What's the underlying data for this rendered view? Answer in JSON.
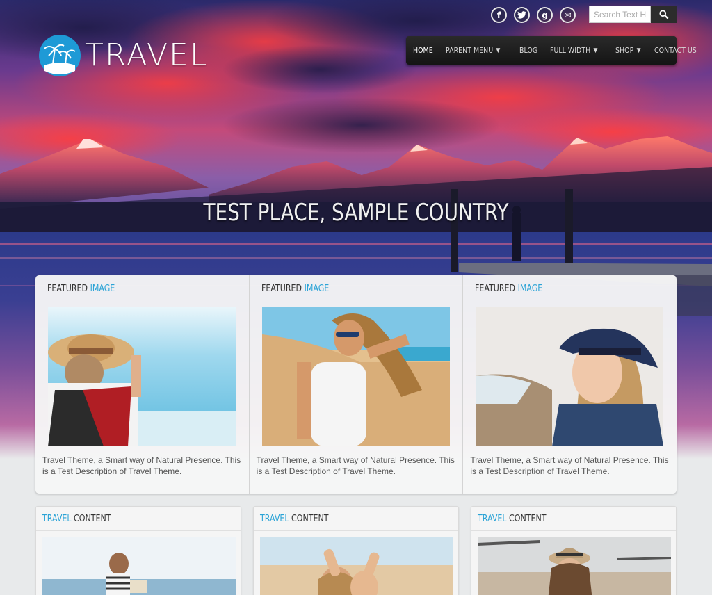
{
  "brand": {
    "logo_text": "TRAVEL"
  },
  "social": [
    {
      "icon": "facebook-icon",
      "glyph": "f"
    },
    {
      "icon": "twitter-icon",
      "glyph": "t"
    },
    {
      "icon": "google-plus-icon",
      "glyph": "g"
    },
    {
      "icon": "email-icon",
      "glyph": "✉"
    }
  ],
  "search": {
    "placeholder": "Search Text H",
    "button_icon": "search-icon"
  },
  "nav": {
    "items": [
      {
        "label": "Home",
        "active": true,
        "has_dropdown": false
      },
      {
        "label": "Parent Menu",
        "has_dropdown": true
      },
      {
        "label": "Blog",
        "has_dropdown": false
      },
      {
        "label": "Full Width",
        "has_dropdown": true
      },
      {
        "label": "Shop",
        "has_dropdown": true
      },
      {
        "label": "Contact Us",
        "has_dropdown": false
      }
    ],
    "caret": "▼"
  },
  "hero": {
    "title": "TEST PLACE, SAMPLE COUNTRY"
  },
  "featured": {
    "items": [
      {
        "heading_main": "FEATURED",
        "heading_accent": "IMAGE",
        "description": "Travel Theme, a Smart way of Natural Presence. This is a Test Description of Travel Theme."
      },
      {
        "heading_main": "FEATURED",
        "heading_accent": "IMAGE",
        "description": "Travel Theme, a Smart way of Natural Presence. This is a Test Description of Travel Theme."
      },
      {
        "heading_main": "FEATURED",
        "heading_accent": "IMAGE",
        "description": "Travel Theme, a Smart way of Natural Presence. This is a Test Description of Travel Theme."
      }
    ]
  },
  "content": {
    "items": [
      {
        "heading_accent": "TRAVEL",
        "heading_main": "CONTENT"
      },
      {
        "heading_accent": "TRAVEL",
        "heading_main": "CONTENT"
      },
      {
        "heading_accent": "TRAVEL",
        "heading_main": "CONTENT"
      }
    ]
  },
  "colors": {
    "accent": "#2aa3d6",
    "nav_bg": "#1c1c1c"
  }
}
